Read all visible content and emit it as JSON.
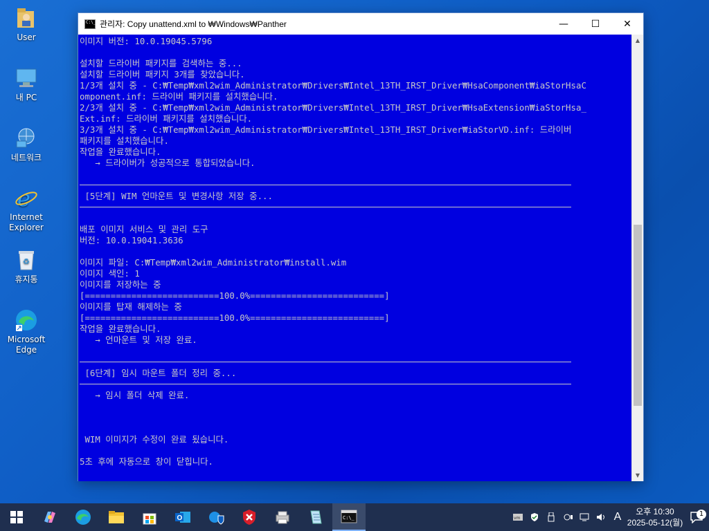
{
  "desktop": {
    "icons": [
      {
        "label": "User"
      },
      {
        "label": "내 PC"
      },
      {
        "label": "네트워크"
      },
      {
        "label": "Internet\nExplorer"
      },
      {
        "label": "휴지통"
      },
      {
        "label": "Microsoft\nEdge"
      }
    ]
  },
  "window": {
    "title": "관리자:  Copy unattend.xml to ₩Windows₩Panther",
    "controls": {
      "minimize": "—",
      "maximize": "☐",
      "close": "✕"
    }
  },
  "console": {
    "lines": [
      "이미지 버전: 10.0.19045.5796",
      "",
      "설치할 드라이버 패키지를 검색하는 중...",
      "설치할 드라이버 패키지 3개를 찾았습니다.",
      "1/3개 설치 중 - C:₩Temp₩xml2wim_Administrator₩Drivers₩Intel_13TH_IRST_Driver₩HsaComponent₩iaStorHsaC",
      "omponent.inf: 드라이버 패키지를 설치했습니다.",
      "2/3개 설치 중 - C:₩Temp₩xml2wim_Administrator₩Drivers₩Intel_13TH_IRST_Driver₩HsaExtension₩iaStorHsa_",
      "Ext.inf: 드라이버 패키지를 설치했습니다.",
      "3/3개 설치 중 - C:₩Temp₩xml2wim_Administrator₩Drivers₩Intel_13TH_IRST_Driver₩iaStorVD.inf: 드라이버",
      "패키지를 설치했습니다.",
      "작업을 완료했습니다.",
      "   → 드라이버가 성공적으로 통합되었습니다.",
      "",
      "---",
      " [5단계] WIM 언마운트 및 변경사항 저장 중...",
      "---",
      "",
      "배포 이미지 서비스 및 관리 도구",
      "버전: 10.0.19041.3636",
      "",
      "이미지 파일: C:₩Temp₩xml2wim_Administrator₩install.wim",
      "이미지 색인: 1",
      "이미지를 저장하는 중",
      "[==========================100.0%==========================]",
      "이미지를 탑재 해제하는 중",
      "[==========================100.0%==========================]",
      "작업을 완료했습니다.",
      "   → 언마운트 및 저장 완료.",
      "",
      "---",
      " [6단계] 임시 마운트 폴더 정리 중...",
      "---",
      "   → 임시 폴더 삭제 완료.",
      "",
      "",
      "",
      " WIM 이미지가 수정이 완료 됬습니다.",
      "",
      "5초 후에 자동으로 창이 닫힙니다."
    ]
  },
  "taskbar": {
    "apps": [
      {
        "name": "start"
      },
      {
        "name": "copilot"
      },
      {
        "name": "edge"
      },
      {
        "name": "file-explorer"
      },
      {
        "name": "store"
      },
      {
        "name": "outlook"
      },
      {
        "name": "security"
      },
      {
        "name": "shield-app"
      },
      {
        "name": "printer-app"
      },
      {
        "name": "notepad-app"
      },
      {
        "name": "cmd",
        "active": true
      }
    ],
    "tray": {
      "ime": "A",
      "time": "오후 10:30",
      "date": "2025-05-12(월)",
      "notification_count": "1"
    }
  }
}
